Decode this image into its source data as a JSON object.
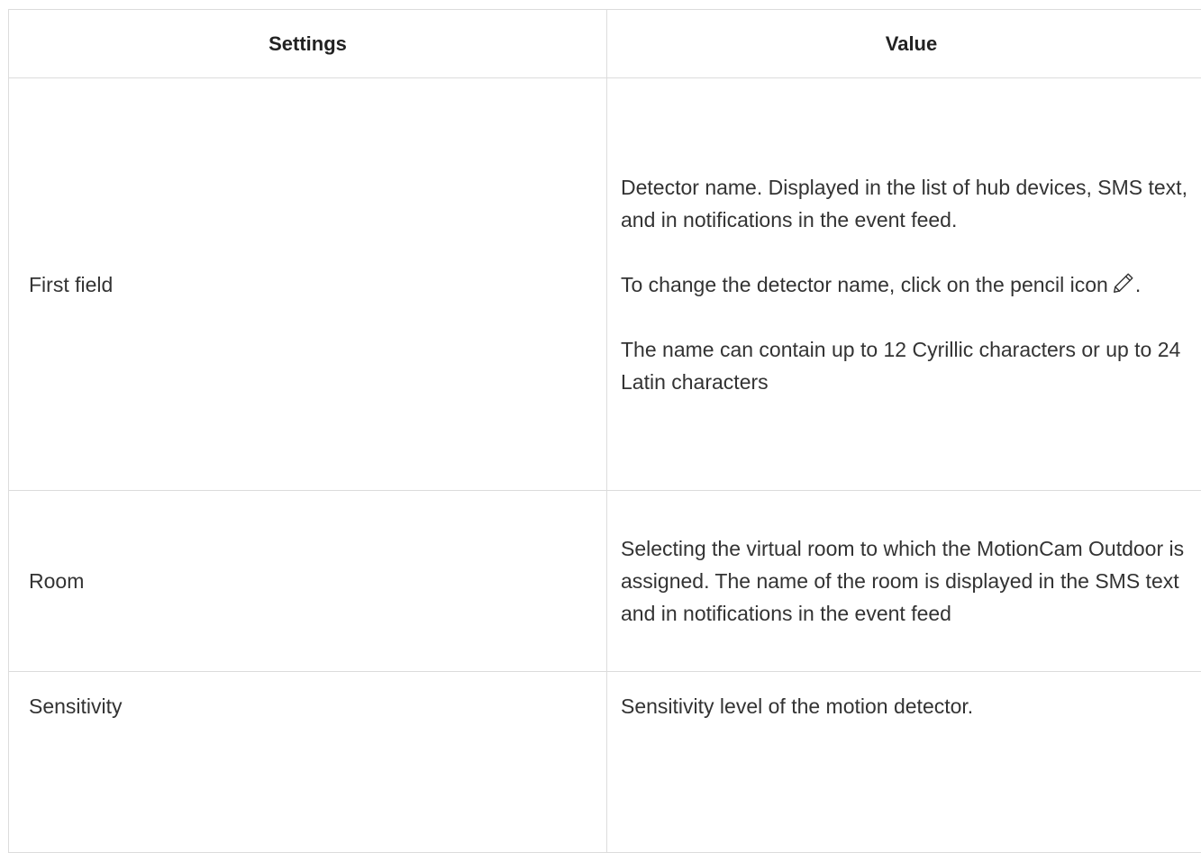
{
  "table": {
    "headers": {
      "settings": "Settings",
      "value": "Value"
    },
    "rows": [
      {
        "setting": "First field",
        "value": {
          "p1": "Detector name. Displayed in the list of hub devices, SMS text, and in notifications in the event feed.",
          "p2_before_icon": "To change the detector name, click on the pencil icon",
          "p2_after_icon": ".",
          "p3": "The name can contain up to 12 Cyrillic characters or up to 24 Latin characters"
        }
      },
      {
        "setting": "Room",
        "value": "Selecting the virtual room to which the MotionCam Outdoor is assigned. The name of the room is displayed in the SMS text and in notifications in the event feed"
      },
      {
        "setting": "Sensitivity",
        "value": "Sensitivity level of the motion detector."
      }
    ]
  },
  "icons": {
    "edit": "pencil-icon"
  }
}
